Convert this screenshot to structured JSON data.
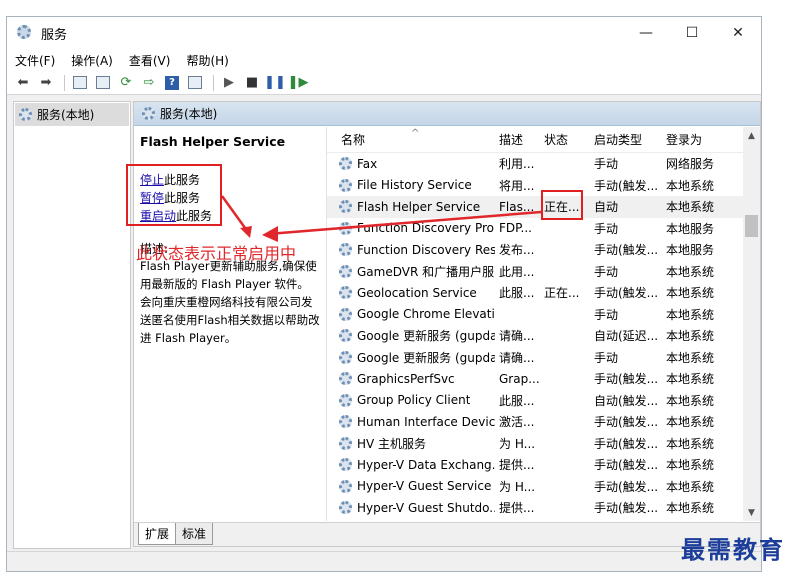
{
  "window": {
    "title": "服务",
    "controls": [
      "—",
      "☐",
      "✕"
    ]
  },
  "menu": [
    "文件(F)",
    "操作(A)",
    "查看(V)",
    "帮助(H)"
  ],
  "tree": {
    "root_label": "服务(本地)"
  },
  "content_header": "服务(本地)",
  "details": {
    "service_title": "Flash Helper Service",
    "actions": [
      {
        "link": "停止",
        "suffix": "此服务"
      },
      {
        "link": "暂停",
        "suffix": "此服务"
      },
      {
        "link": "重启动",
        "suffix": "此服务"
      }
    ],
    "desc_label": "描述:",
    "desc_text": "Flash Player更新辅助服务,确保使用最新版的 Flash Player 软件。会向重庆重橙网络科技有限公司发送匿名使用Flash相关数据以帮助改进 Flash Player。"
  },
  "columns": [
    "名称",
    "描述",
    "状态",
    "启动类型",
    "登录为"
  ],
  "rows": [
    {
      "name": "Fax",
      "desc": "利用...",
      "state": "",
      "start": "手动",
      "logon": "网络服务"
    },
    {
      "name": "File History Service",
      "desc": "将用...",
      "state": "",
      "start": "手动(触发...",
      "logon": "本地系统"
    },
    {
      "name": "Flash Helper Service",
      "desc": "Flas...",
      "state": "正在...",
      "start": "自动",
      "logon": "本地系统"
    },
    {
      "name": "Function Discovery Pro...",
      "desc": "FDP...",
      "state": "",
      "start": "手动",
      "logon": "本地服务"
    },
    {
      "name": "Function Discovery Res...",
      "desc": "发布...",
      "state": "",
      "start": "手动(触发...",
      "logon": "本地服务"
    },
    {
      "name": "GameDVR 和广播用户服...",
      "desc": "此用...",
      "state": "",
      "start": "手动",
      "logon": "本地系统"
    },
    {
      "name": "Geolocation Service",
      "desc": "此服...",
      "state": "正在...",
      "start": "手动(触发...",
      "logon": "本地系统"
    },
    {
      "name": "Google Chrome Elevati...",
      "desc": "",
      "state": "",
      "start": "手动",
      "logon": "本地系统"
    },
    {
      "name": "Google 更新服务 (gupda...",
      "desc": "请确...",
      "state": "",
      "start": "自动(延迟...",
      "logon": "本地系统"
    },
    {
      "name": "Google 更新服务 (gupda...",
      "desc": "请确...",
      "state": "",
      "start": "手动",
      "logon": "本地系统"
    },
    {
      "name": "GraphicsPerfSvc",
      "desc": "Grap...",
      "state": "",
      "start": "手动(触发...",
      "logon": "本地系统"
    },
    {
      "name": "Group Policy Client",
      "desc": "此服...",
      "state": "",
      "start": "自动(触发...",
      "logon": "本地系统"
    },
    {
      "name": "Human Interface Devic...",
      "desc": "激活...",
      "state": "",
      "start": "手动(触发...",
      "logon": "本地系统"
    },
    {
      "name": "HV 主机服务",
      "desc": "为 H...",
      "state": "",
      "start": "手动(触发...",
      "logon": "本地系统"
    },
    {
      "name": "Hyper-V Data Exchang...",
      "desc": "提供...",
      "state": "",
      "start": "手动(触发...",
      "logon": "本地系统"
    },
    {
      "name": "Hyper-V Guest Service ...",
      "desc": "为 H...",
      "state": "",
      "start": "手动(触发...",
      "logon": "本地系统"
    },
    {
      "name": "Hyper-V Guest Shutdo...",
      "desc": "提供...",
      "state": "",
      "start": "手动(触发...",
      "logon": "本地系统"
    }
  ],
  "tabs": [
    "扩展",
    "标准"
  ],
  "annotation": "此状态表示正常启用中",
  "watermark": "最需教育",
  "colors": {
    "annotation_red": "#e0282c",
    "watermark_blue": "#1c3e9a",
    "header_blue": "#c5d6e8"
  }
}
